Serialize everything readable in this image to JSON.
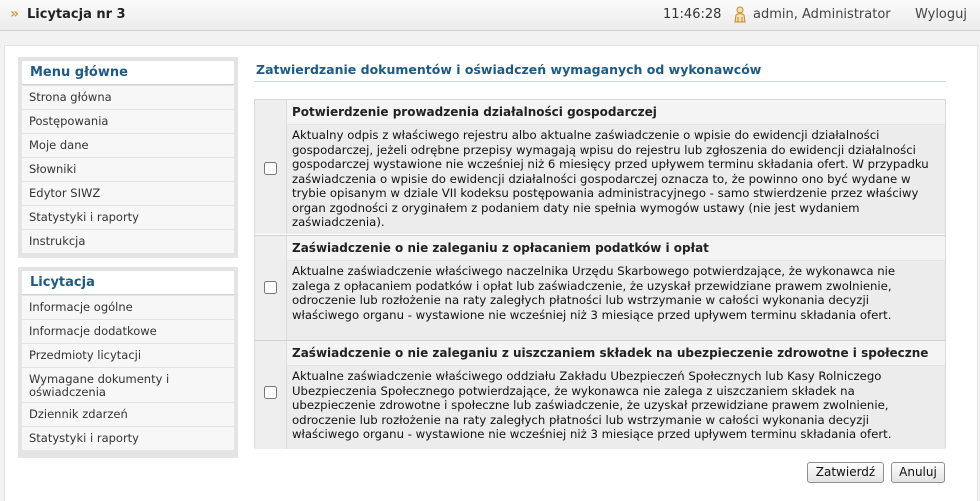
{
  "header": {
    "arrow": "»",
    "title": "Licytacja nr 3",
    "time": "11:46:28",
    "user": "admin, Administrator",
    "logout": "Wyloguj"
  },
  "menus": [
    {
      "title": "Menu główne",
      "items": [
        "Strona główna",
        "Postępowania",
        "Moje dane",
        "Słowniki",
        "Edytor SIWZ",
        "Statystyki i raporty",
        "Instrukcja"
      ]
    },
    {
      "title": "Licytacja",
      "items": [
        "Informacje ogólne",
        "Informacje dodatkowe",
        "Przedmioty licytacji",
        "Wymagane dokumenty i oświadczenia",
        "Dziennik zdarzeń",
        "Statystyki i raporty"
      ]
    }
  ],
  "content": {
    "title": "Zatwierdzanie dokumentów i oświadczeń wymaganych od wykonawców",
    "documents": [
      {
        "heading": "Potwierdzenie prowadzenia działalności gospodarczej",
        "text": "Aktualny odpis z właściwego rejestru albo aktualne zaświadczenie o wpisie do ewidencji działalności gospodarczej, jeżeli odrębne przepisy wymagają wpisu do rejestru lub zgłoszenia do ewidencji działalności gospodarczej wystawione nie wcześniej niż 6 miesięcy przed upływem terminu składania ofert. W przypadku zaświadczenia o wpisie do ewidencji działalności gospodarczej oznacza to, że powinno ono być wydane w trybie opisanym w dziale VII kodeksu postępowania administracyjnego - samo stwierdzenie przez właściwy organ zgodności z oryginałem z podaniem daty nie spełnia wymogów ustawy (nie jest wydaniem zaświadczenia).",
        "checked": false
      },
      {
        "heading": "Zaświadczenie o nie zaleganiu z opłacaniem podatków i opłat",
        "text": "Aktualne zaświadczenie właściwego naczelnika Urzędu Skarbowego potwierdzające, że wykonawca nie zalega z opłacaniem podatków i opłat lub zaświadczenie, że uzyskał przewidziane prawem zwolnienie, odroczenie lub rozłożenie na raty zaległych płatności lub wstrzymanie w całości wykonania decyzji właściwego organu - wystawione nie wcześniej niż 3 miesiące przed upływem terminu składania ofert.",
        "checked": false
      },
      {
        "heading": "Zaświadczenie o nie zaleganiu z uiszczaniem składek na ubezpieczenie zdrowotne i społeczne",
        "text": "Aktualne zaświadczenie właściwego oddziału Zakładu Ubezpieczeń Społecznych lub Kasy Rolniczego Ubezpieczenia Społecznego potwierdzające, że wykonawca nie zalega z uiszczaniem składek na ubezpieczenie zdrowotne i społeczne lub zaświadczenie, że uzyskał przewidziane prawem zwolnienie, odroczenie lub rozłożenie na raty zaległych płatności lub wstrzymanie w całości wykonania decyzji właściwego organu - wystawione nie wcześniej niż 3 miesiące przed upływem terminu składania ofert.",
        "checked": false
      }
    ]
  },
  "buttons": {
    "confirm": "Zatwierdź",
    "cancel": "Anuluj"
  },
  "icons": {
    "user": "user-icon"
  },
  "colors": {
    "accent": "#1e5a82",
    "arrow": "#c8a040"
  }
}
